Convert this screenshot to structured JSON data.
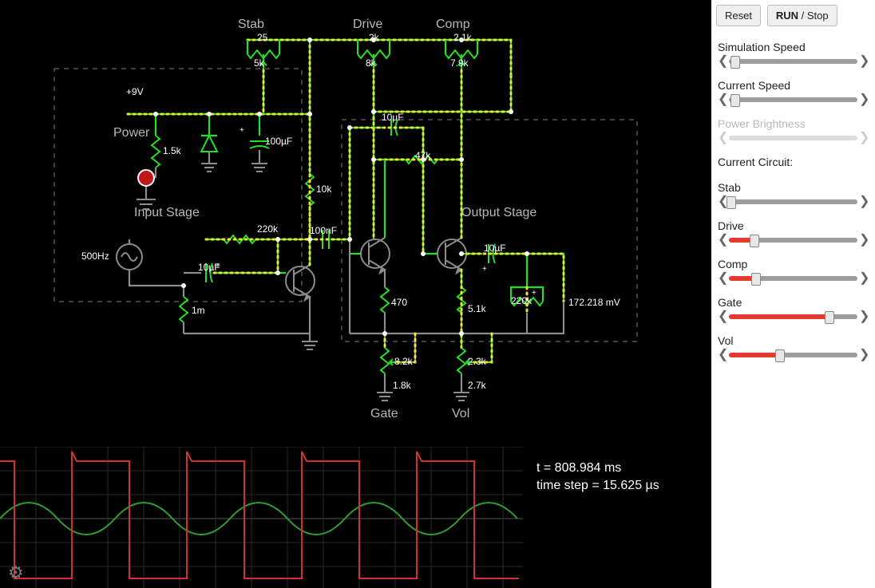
{
  "buttons": {
    "reset_label": "Reset",
    "run_bold": "RUN",
    "run_sep": " / ",
    "stop": "Stop"
  },
  "sliders_top": [
    {
      "id": "sim-speed",
      "label": "Simulation Speed",
      "pos": 0.05,
      "disabled": false,
      "red": false
    },
    {
      "id": "cur-speed",
      "label": "Current Speed",
      "pos": 0.05,
      "disabled": false,
      "red": false
    },
    {
      "id": "pow-bright",
      "label": "Power Brightness",
      "pos": 0.0,
      "disabled": true,
      "red": false
    }
  ],
  "current_circuit_label": "Current Circuit:",
  "sliders_circuit": [
    {
      "id": "stab",
      "label": "Stab",
      "pos": 0.02,
      "red": false
    },
    {
      "id": "drive",
      "label": "Drive",
      "pos": 0.2,
      "red": true
    },
    {
      "id": "comp",
      "label": "Comp",
      "pos": 0.21,
      "red": true
    },
    {
      "id": "gate",
      "label": "Gate",
      "pos": 0.78,
      "red": true
    },
    {
      "id": "vol",
      "label": "Vol",
      "pos": 0.4,
      "red": true
    }
  ],
  "section_labels": {
    "power": "Power",
    "input_stage": "Input Stage",
    "output_stage": "Output Stage",
    "stab": "Stab",
    "drive": "Drive",
    "comp": "Comp",
    "gate": "Gate",
    "vol": "Vol"
  },
  "components": {
    "rail": "+9V",
    "src_freq": "500Hz",
    "r_power": "1.5k",
    "c_power": "100µF",
    "stab_top": "25",
    "stab_pot": "5k",
    "drive_top": "2k",
    "drive_pot": "8k",
    "comp_top": "2.1k",
    "comp_pot": "7.9k",
    "r_fb": "220k",
    "r_mid": "10k",
    "c_mid": "100nF",
    "c_topmid": "10µF",
    "r_47k": "47k",
    "c_in": "10µF",
    "r_in": "1m",
    "r_e1": "470",
    "r_e2": "5.1k",
    "c_out": "10µF",
    "r_outfb": "220k",
    "meter": "172.218 mV",
    "gate_top": "8.2k",
    "gate_bot": "1.8k",
    "vol_top": "2.3k",
    "vol_bot": "2.7k"
  },
  "scope": {
    "t_line": "t = 808.984 ms",
    "step_line": "time step = 15.625 µs"
  },
  "icons": {
    "gear": "⚙"
  }
}
